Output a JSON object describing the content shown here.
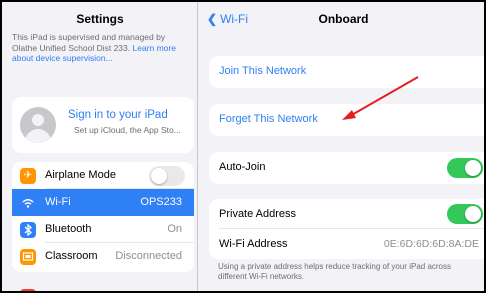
{
  "sidebar": {
    "title": "Settings",
    "supervised_text": "This iPad is supervised and managed by Olathe Unified School Dist 233.",
    "supervised_link": "Learn more about device supervision...",
    "profile": {
      "title": "Sign in to your iPad",
      "subtitle": "Set up iCloud, the App Sto..."
    },
    "items": [
      {
        "label": "Airplane Mode",
        "value": "",
        "icon": "airplane-icon",
        "color": "#ff9500"
      },
      {
        "label": "Wi-Fi",
        "value": "OPS233",
        "icon": "wifi-icon",
        "color": "#2f7ff5"
      },
      {
        "label": "Bluetooth",
        "value": "On",
        "icon": "bluetooth-icon",
        "color": "#2f7ff5"
      },
      {
        "label": "Classroom",
        "value": "Disconnected",
        "icon": "classroom-icon",
        "color": "#ff9500"
      }
    ]
  },
  "detail": {
    "back_label": "Wi-Fi",
    "title": "Onboard",
    "join_label": "Join This Network",
    "forget_label": "Forget This Network",
    "autojoin_label": "Auto-Join",
    "private_address_label": "Private Address",
    "wifi_address_label": "Wi-Fi Address",
    "wifi_address_value": "0E:6D:6D:6D:8A:DE",
    "footer_note": "Using a private address helps reduce tracking of your iPad across different Wi-Fi networks."
  },
  "colors": {
    "accent": "#2f7ff5",
    "toggle_on": "#34c759",
    "annotation_arrow": "#e02020"
  }
}
